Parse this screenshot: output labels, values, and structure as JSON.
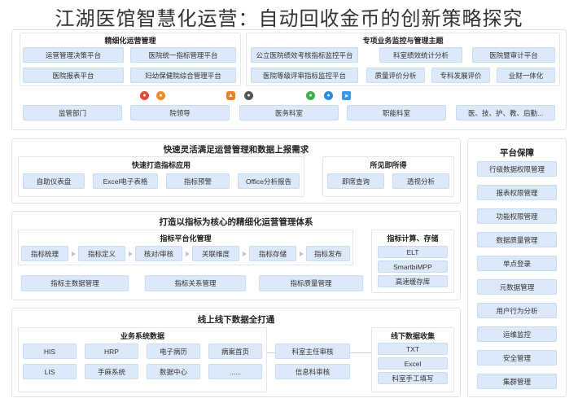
{
  "title": "江湖医馆智慧化运营：自动回收金币的创新策略探究",
  "top_left": {
    "title": "精细化运营管理",
    "items": [
      "运营管理决策平台",
      "医院统一指标管理平台",
      "医院报表平台",
      "妇幼保健院综合管理平台"
    ]
  },
  "top_right": {
    "title": "专项业务监控与管理主题",
    "items": [
      "公立医院绩效考核指标监控平台",
      "科室绩效统计分析",
      "医院暨审计平台",
      "医院等级评审指标监控平台",
      "质量评价分析",
      "专科发展评价",
      "业财一体化"
    ]
  },
  "icons": [
    {
      "name": "chrome-icon",
      "color": "#e04a3b"
    },
    {
      "name": "firefox-icon",
      "color": "#f08a24"
    },
    {
      "name": "android-icon",
      "color": "#e8812a"
    },
    {
      "name": "apple-icon",
      "color": "#555555"
    },
    {
      "name": "wechat-icon",
      "color": "#3cb04a"
    },
    {
      "name": "chat-icon",
      "color": "#2a8be0"
    },
    {
      "name": "send-icon",
      "color": "#3b9ae8"
    }
  ],
  "users": [
    "监管部门",
    "院领导",
    "医务科室",
    "职能科室",
    "医、技、护、教、后勤..."
  ],
  "section_flex": {
    "title": "快速灵活满足运营管理和数据上报需求",
    "left_title": "快速打造指标应用",
    "left_items": [
      "自助仪表盘",
      "Excel电子表格",
      "指标预警",
      "Office分析报告"
    ],
    "right_title": "所见即所得",
    "right_items": [
      "即席查询",
      "透视分析"
    ]
  },
  "section_index": {
    "title": "打造以指标为核心的精细化运营管理体系",
    "platform_title": "指标平台化管理",
    "flow": [
      "指标梳理",
      "指标定义",
      "核对/审核",
      "关联维度",
      "指标存储",
      "指标发布"
    ],
    "bottom": [
      "指标主数据管理",
      "指标关系管理",
      "指标质量管理"
    ],
    "calc_title": "指标计算、存储",
    "calc_items": [
      "ELT",
      "SmartbiMPP",
      "高速缓存库"
    ]
  },
  "section_data": {
    "title": "线上线下数据全打通",
    "biz_title": "业务系统数据",
    "biz_row1": [
      "HIS",
      "HRP",
      "电子病历",
      "病案首页"
    ],
    "biz_row2": [
      "LIS",
      "手麻系统",
      "数据中心",
      "......"
    ],
    "review": [
      "科室主任审核",
      "信息科审核"
    ],
    "offline_title": "线下数据收集",
    "offline_items": [
      "TXT",
      "Excel",
      "科室手工填写"
    ]
  },
  "platform_guarantee": {
    "title": "平台保障",
    "items": [
      "行级数据权限管理",
      "报表权限管理",
      "功能权限管理",
      "数据质量管理",
      "单点登录",
      "元数据管理",
      "用户行为分析",
      "运维监控",
      "安全管理",
      "集群管理"
    ]
  }
}
